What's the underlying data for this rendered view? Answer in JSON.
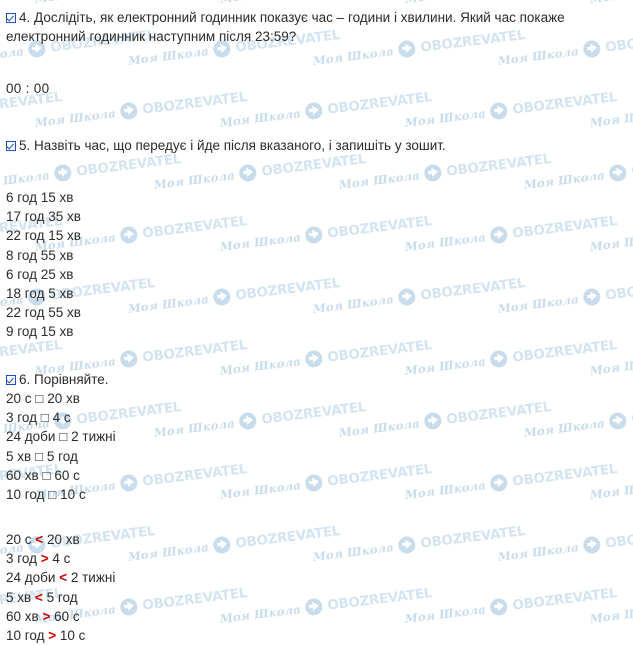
{
  "page": {
    "language": "uk",
    "background_color": "#ffffff",
    "text_color": "#2b2b2b",
    "accent_color": "#1f4fbf",
    "answer_color": "#cc0000",
    "watermark_color": "#cfe1ef"
  },
  "watermark": {
    "school_text": "Моя Школа",
    "brand_text": "OBOZREVATEL",
    "icon": "globe-icon"
  },
  "exercises": [
    {
      "id": "exercise-4",
      "number": "4.",
      "checkbox": "checked",
      "prompt": "Дослідіть, як електронний годинник показує час – години і хвилини. Який час покаже електронний годинник наступним після 23:59?",
      "answer_display": "00 : 00"
    },
    {
      "id": "exercise-5",
      "number": "5.",
      "checkbox": "checked",
      "prompt": "Назвіть час, що передує і йде після вказаного, і запишіть у зошит.",
      "items": [
        "6 год 15 хв",
        "17 год 35 хв",
        "22 год 15 хв",
        "8 год 55 хв",
        "6 год 25 хв",
        "18 год 5 хв",
        "22 год 55 хв",
        "9 год 15 хв"
      ]
    },
    {
      "id": "exercise-6",
      "number": "6.",
      "checkbox": "checked",
      "prompt": "Порівняйте.",
      "tasks": [
        {
          "left": "20 с",
          "box": "□",
          "right": "20 хв"
        },
        {
          "left": "3 год",
          "box": "□",
          "right": "4 с"
        },
        {
          "left": "24 доби",
          "box": "□",
          "right": "2 тижні"
        },
        {
          "left": "5 хв",
          "box": "□",
          "right": "5 год"
        },
        {
          "left": "60 хв",
          "box": "□",
          "right": "60 с"
        },
        {
          "left": "10 год",
          "box": "□",
          "right": "10 с"
        }
      ],
      "solutions": [
        {
          "left": "20 с",
          "op": "<",
          "right": "20 хв"
        },
        {
          "left": "3 год",
          "op": ">",
          "right": "4 с"
        },
        {
          "left": "24 доби",
          "op": "<",
          "right": "2 тижні"
        },
        {
          "left": "5 хв",
          "op": "<",
          "right": "5 год"
        },
        {
          "left": "60 хв",
          "op": ">",
          "right": "60 с"
        },
        {
          "left": "10 год",
          "op": ">",
          "right": "10 с"
        }
      ]
    }
  ]
}
